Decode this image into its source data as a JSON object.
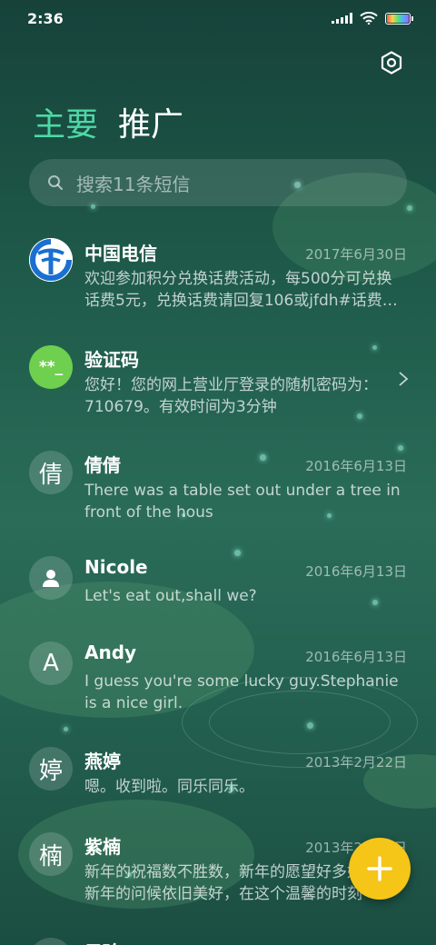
{
  "status": {
    "time": "2:36"
  },
  "tabs": {
    "primary": "主要",
    "secondary": "推广"
  },
  "search": {
    "placeholder": "搜索11条短信"
  },
  "accent": "#4dd8a6",
  "fab_color": "#f5c518",
  "messages": [
    {
      "name": "中国电信",
      "date": "2017年6月30日",
      "preview": "欢迎参加积分兑换话费活动，每500分可兑换话费5元，兑换话费请回复106或jfdh#话费…",
      "avatar": "china-telecom-logo"
    },
    {
      "name": "验证码",
      "date": "",
      "preview": "您好！您的网上营业厅登录的随机密码为：710679。有效时间为3分钟",
      "avatar_text": "**_",
      "avatar_color": "#6fcf4e"
    },
    {
      "name": "倩倩",
      "date": "2016年6月13日",
      "preview": "There was a table set out under a tree in front of the hous",
      "avatar_text": "倩"
    },
    {
      "name": "Nicole",
      "date": "2016年6月13日",
      "preview": "Let's eat out,shall we?",
      "avatar": "person-icon"
    },
    {
      "name": "Andy",
      "date": "2016年6月13日",
      "preview": "I guess you're some lucky guy.Stephanie is a nice girl.",
      "avatar_text": "A"
    },
    {
      "name": "燕婷",
      "date": "2013年2月22日",
      "preview": "嗯。收到啦。同乐同乐。",
      "avatar_text": "婷"
    },
    {
      "name": "紫楠",
      "date": "2013年2月22日",
      "preview": "新年的祝福数不胜数，新年的愿望好多好多，新年的问候依旧美好，在这个温馨的时刻",
      "avatar_text": "楠"
    },
    {
      "name": "子玲",
      "date": "",
      "preview": "",
      "avatar_text": ""
    }
  ]
}
